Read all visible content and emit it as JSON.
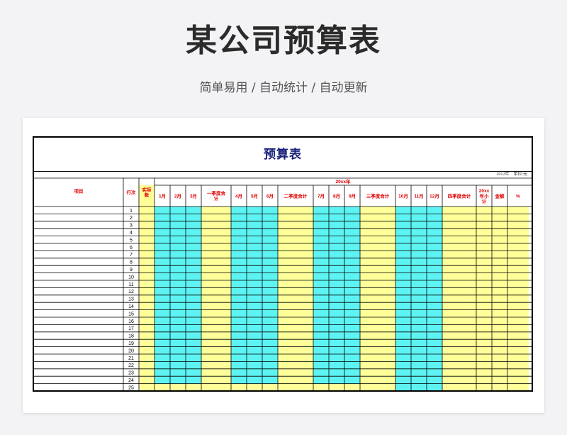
{
  "page": {
    "title": "某公司预算表",
    "subtitle": "简单易用  /  自动统计  /  自动更新"
  },
  "sheet": {
    "title": "预算表",
    "unit_line": "2012年    单位:元",
    "year_header": "20xx年",
    "columns": [
      {
        "label": "项目",
        "lines": [
          "项目"
        ],
        "fill": "white"
      },
      {
        "label": "行次",
        "lines": [
          "行次"
        ],
        "fill": "white"
      },
      {
        "label": "实际数",
        "lines": [
          "实际",
          "数"
        ],
        "fill": "yellow"
      },
      {
        "label": "1月",
        "lines": [
          "1月"
        ],
        "fill": "cyan"
      },
      {
        "label": "2月",
        "lines": [
          "2月"
        ],
        "fill": "cyan"
      },
      {
        "label": "3月",
        "lines": [
          "3月"
        ],
        "fill": "cyan"
      },
      {
        "label": "一季度合计",
        "lines": [
          "一季度合",
          "计"
        ],
        "fill": "yellow"
      },
      {
        "label": "4月",
        "lines": [
          "4月"
        ],
        "fill": "cyan"
      },
      {
        "label": "5月",
        "lines": [
          "5月"
        ],
        "fill": "cyan"
      },
      {
        "label": "6月",
        "lines": [
          "6月"
        ],
        "fill": "cyan"
      },
      {
        "label": "二季度合计",
        "lines": [
          "二季度合计"
        ],
        "fill": "yellow"
      },
      {
        "label": "7月",
        "lines": [
          "7月"
        ],
        "fill": "cyan"
      },
      {
        "label": "8月",
        "lines": [
          "8月"
        ],
        "fill": "cyan"
      },
      {
        "label": "9月",
        "lines": [
          "9月"
        ],
        "fill": "cyan"
      },
      {
        "label": "三季度合计",
        "lines": [
          "三季度合计"
        ],
        "fill": "yellow"
      },
      {
        "label": "10月",
        "lines": [
          "10月"
        ],
        "fill": "cyan"
      },
      {
        "label": "11月",
        "lines": [
          "11月"
        ],
        "fill": "cyan"
      },
      {
        "label": "12月",
        "lines": [
          "12月"
        ],
        "fill": "cyan"
      },
      {
        "label": "四季度合计",
        "lines": [
          "四季度合计"
        ],
        "fill": "yellow"
      },
      {
        "label": "20xx年小计",
        "lines": [
          "20xx",
          "年小",
          "计"
        ],
        "fill": "yellow"
      },
      {
        "label": "金额",
        "lines": [
          "金额"
        ],
        "fill": "yellow"
      },
      {
        "label": "%",
        "lines": [
          "%"
        ],
        "fill": "yellow"
      }
    ],
    "rows": [
      "1",
      "2",
      "3",
      "4",
      "5",
      "6",
      "7",
      "8",
      "9",
      "10",
      "11",
      "12",
      "13",
      "14",
      "15",
      "16",
      "17",
      "18",
      "19",
      "20",
      "21",
      "22",
      "23",
      "24",
      "25"
    ]
  },
  "colors": {
    "cyan": "#5ef3f3",
    "yellow": "#ffff99",
    "header_text": "#e00000",
    "title_text": "#17207a"
  }
}
